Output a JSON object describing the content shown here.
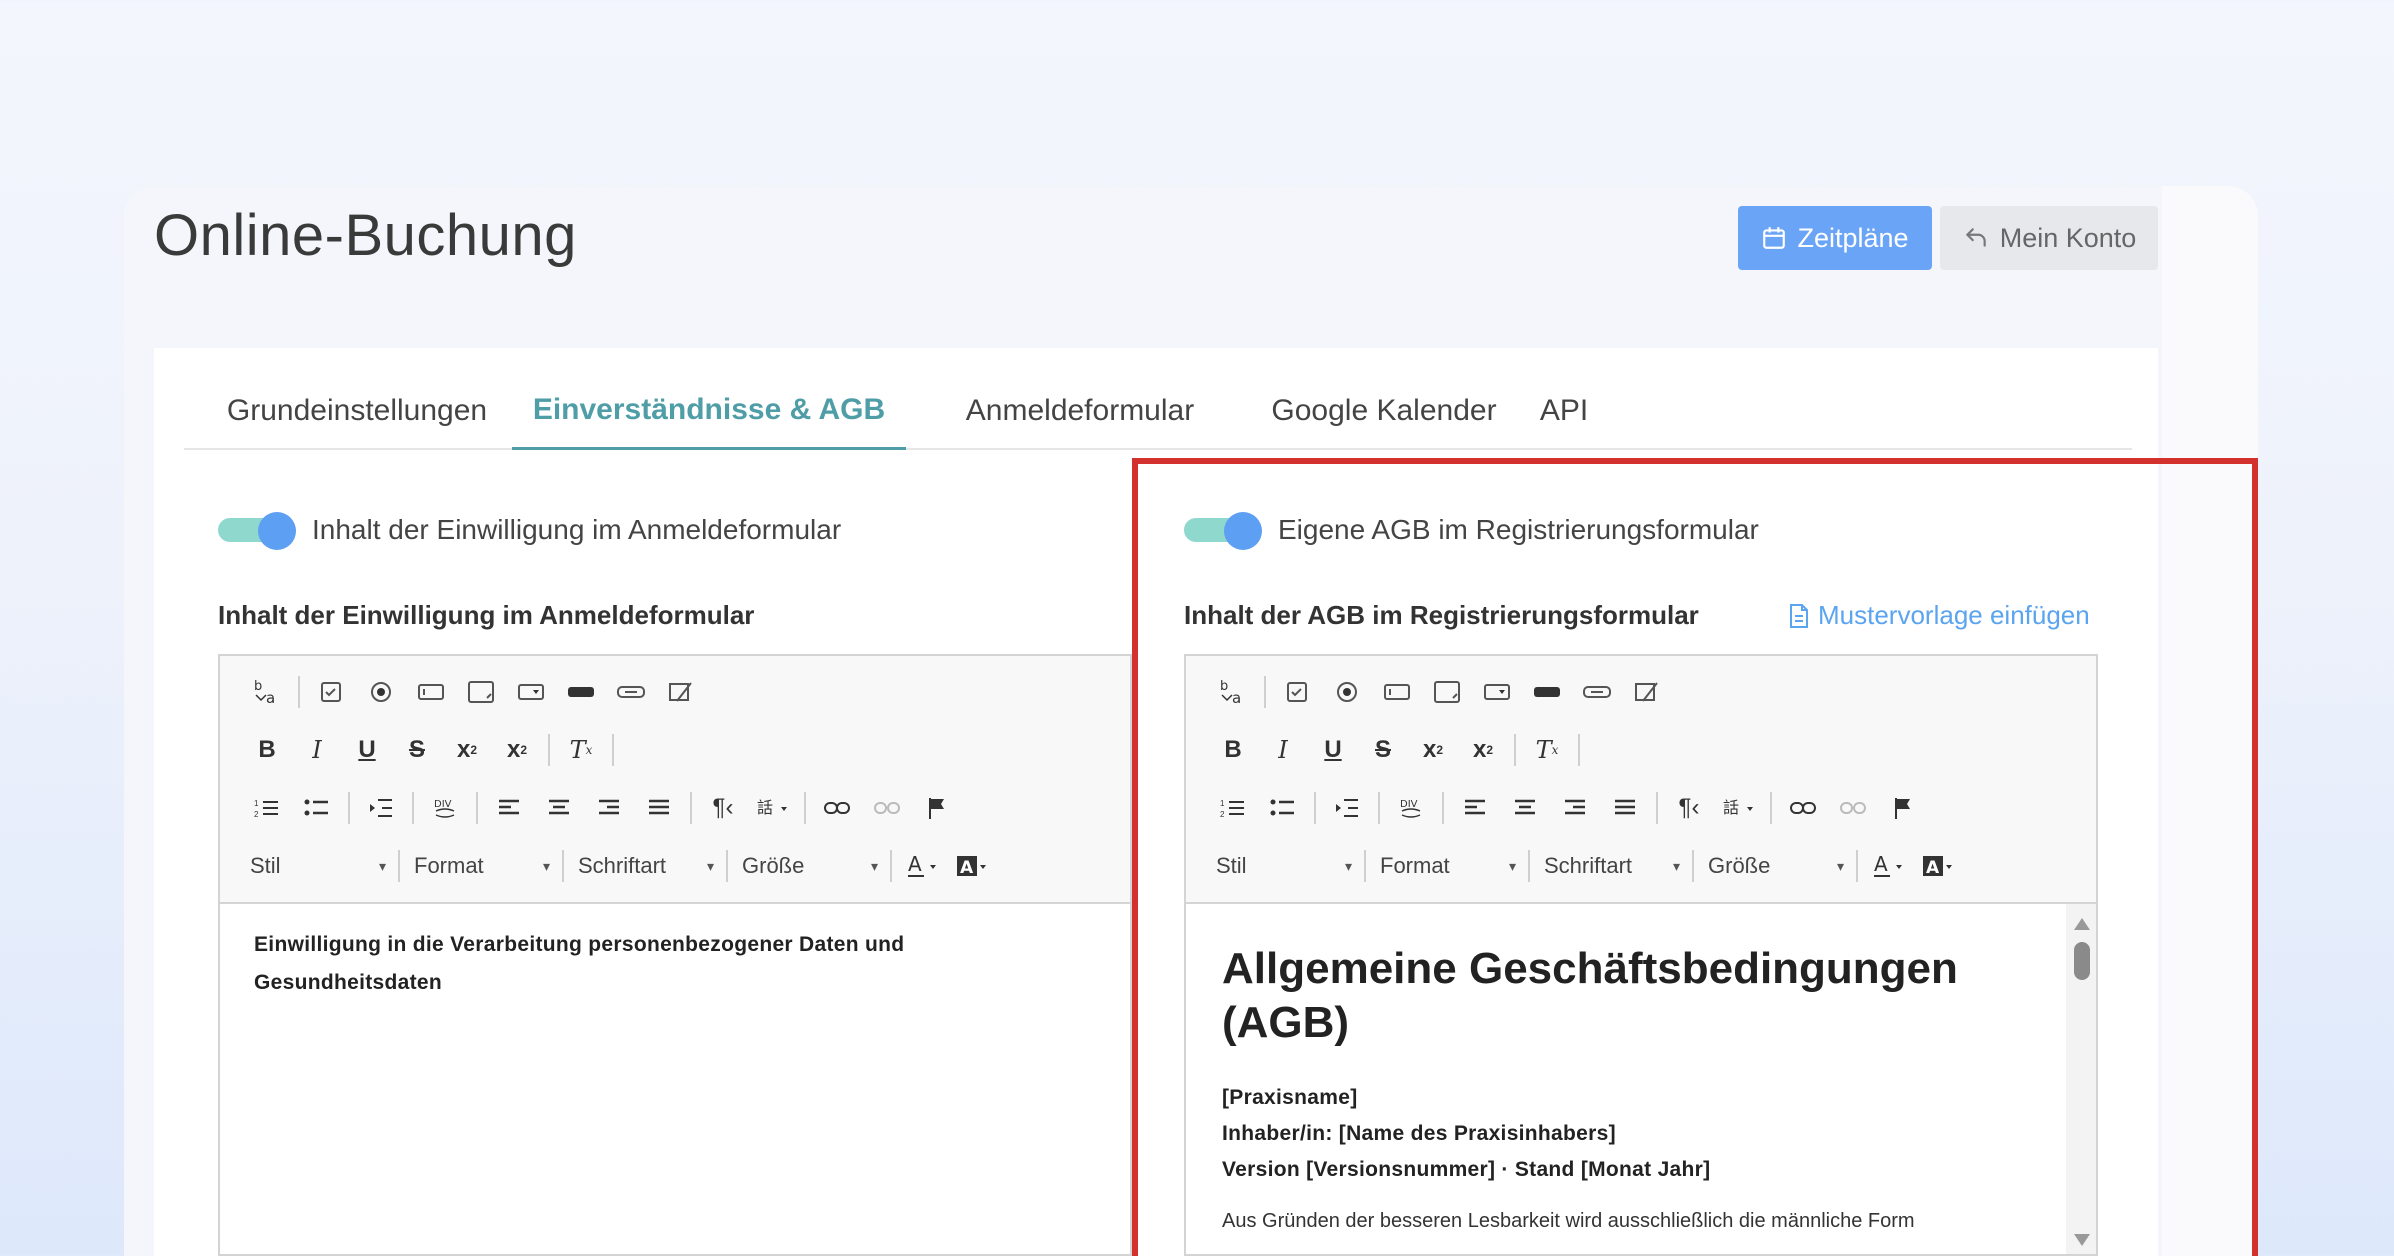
{
  "page_title": "Online-Buchung",
  "header_buttons": {
    "schedules": "Zeitpläne",
    "account": "Mein Konto"
  },
  "tabs": [
    {
      "label": "Grundeinstellungen",
      "active": false
    },
    {
      "label": "Einverständnisse & AGB",
      "active": true
    },
    {
      "label": "Anmeldeformular",
      "active": false
    },
    {
      "label": "Google Kalender",
      "active": false
    },
    {
      "label": "API",
      "active": false
    }
  ],
  "left": {
    "toggle_label": "Inhalt der Einwilligung im Anmeldeformular",
    "toggle_on": true,
    "field_label": "Inhalt der Einwilligung im Anmeldeformular",
    "content_text": "Einwilligung in die Verarbeitung personenbezogener Daten und Gesundheitsdaten"
  },
  "right": {
    "toggle_label": "Eigene AGB im Registrierungsformular",
    "toggle_on": true,
    "field_label": "Inhalt der AGB im Registrierungsformular",
    "insert_link": "Mustervorlage einfügen",
    "heading": "Allgemeine Geschäftsbedingungen (AGB)",
    "line1": "[Praxisname]",
    "line2": "Inhaber/in: [Name des Praxisinhabers]",
    "line3": "Version [Versionsnummer] · Stand [Monat Jahr]",
    "line4": "Aus Gründen der besseren Lesbarkeit wird ausschließlich die männliche Form"
  },
  "editor_combos": {
    "style": "Stil",
    "format": "Format",
    "font": "Schriftart",
    "size": "Größe"
  },
  "colors": {
    "accent_teal": "#4f9da6",
    "primary_button": "#6aa4f6",
    "highlight_red": "#d3312d",
    "toggle_knob": "#5d9ff2",
    "toggle_track": "#8fd8cd",
    "link_blue": "#5aa4f0"
  }
}
